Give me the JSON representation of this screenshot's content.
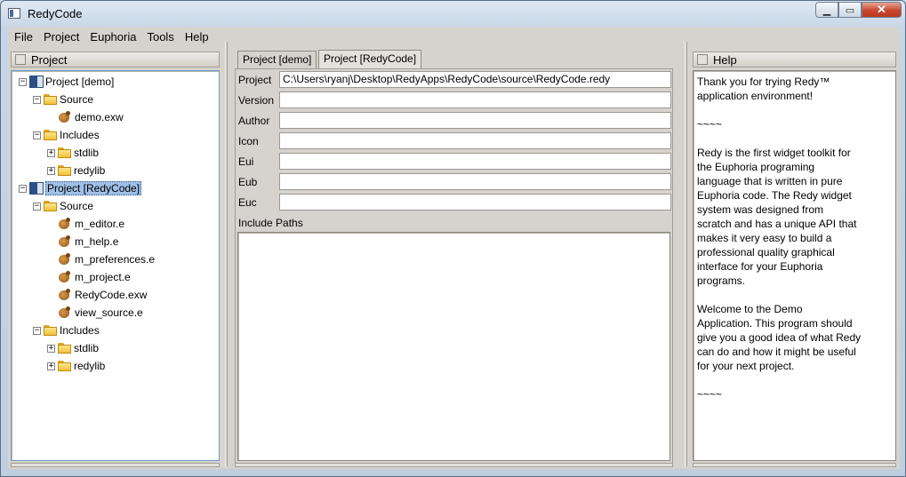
{
  "window": {
    "title": "RedyCode"
  },
  "menu": [
    "File",
    "Project",
    "Euphoria",
    "Tools",
    "Help"
  ],
  "project_pane": {
    "title": "Project",
    "tree": [
      {
        "label": "Project [demo]",
        "icon": "project-icon",
        "level": 0,
        "expander": "−"
      },
      {
        "label": "Source",
        "icon": "folder-icon",
        "level": 1,
        "expander": "−"
      },
      {
        "label": "demo.exw",
        "icon": "euphoria-file-icon",
        "level": 2,
        "expander": ""
      },
      {
        "label": "Includes",
        "icon": "folder-icon",
        "level": 1,
        "expander": "−"
      },
      {
        "label": "stdlib",
        "icon": "folder-icon",
        "level": 2,
        "expander": "+"
      },
      {
        "label": "redylib",
        "icon": "folder-icon",
        "level": 2,
        "expander": "+"
      },
      {
        "label": "Project [RedyCode]",
        "icon": "project-icon",
        "level": 0,
        "expander": "−",
        "selected": true
      },
      {
        "label": "Source",
        "icon": "folder-icon",
        "level": 1,
        "expander": "−"
      },
      {
        "label": "m_editor.e",
        "icon": "euphoria-file-icon",
        "level": 2,
        "expander": ""
      },
      {
        "label": "m_help.e",
        "icon": "euphoria-file-icon",
        "level": 2,
        "expander": ""
      },
      {
        "label": "m_preferences.e",
        "icon": "euphoria-file-icon",
        "level": 2,
        "expander": ""
      },
      {
        "label": "m_project.e",
        "icon": "euphoria-file-icon",
        "level": 2,
        "expander": ""
      },
      {
        "label": "RedyCode.exw",
        "icon": "euphoria-file-icon",
        "level": 2,
        "expander": ""
      },
      {
        "label": "view_source.e",
        "icon": "euphoria-file-icon",
        "level": 2,
        "expander": ""
      },
      {
        "label": "Includes",
        "icon": "folder-icon",
        "level": 1,
        "expander": "−"
      },
      {
        "label": "stdlib",
        "icon": "folder-icon",
        "level": 2,
        "expander": "+"
      },
      {
        "label": "redylib",
        "icon": "folder-icon",
        "level": 2,
        "expander": "+"
      }
    ]
  },
  "center": {
    "tabs": [
      {
        "label": "Project [demo]",
        "active": false
      },
      {
        "label": "Project [RedyCode]",
        "active": true
      }
    ],
    "fields": [
      {
        "label": "Project",
        "value": "C:\\Users\\ryanj\\Desktop\\RedyApps\\RedyCode\\source\\RedyCode.redy"
      },
      {
        "label": "Version",
        "value": ""
      },
      {
        "label": "Author",
        "value": ""
      },
      {
        "label": "Icon",
        "value": ""
      },
      {
        "label": "Eui",
        "value": ""
      },
      {
        "label": "Eub",
        "value": ""
      },
      {
        "label": "Euc",
        "value": ""
      }
    ],
    "include_paths_label": "Include Paths"
  },
  "help_pane": {
    "title": "Help",
    "text": "Thank you for trying Redy™\napplication environment!\n\n~~~~\n\nRedy is the first widget toolkit for\nthe Euphoria programing\nlanguage that is written in pure\nEuphoria code. The Redy widget\nsystem was designed from\nscratch and has a unique API that\nmakes it very easy to build a\nprofessional quality graphical\ninterface for your Euphoria\nprograms.\n\nWelcome to the Demo\nApplication. This program should\ngive you a good idea of what Redy\ncan do and how it might be useful\nfor your next project.\n\n~~~~"
  },
  "colors": {
    "selection": "#9fc1e8",
    "close_button": "#c8472d",
    "panel_bg": "#d6d3ce"
  }
}
